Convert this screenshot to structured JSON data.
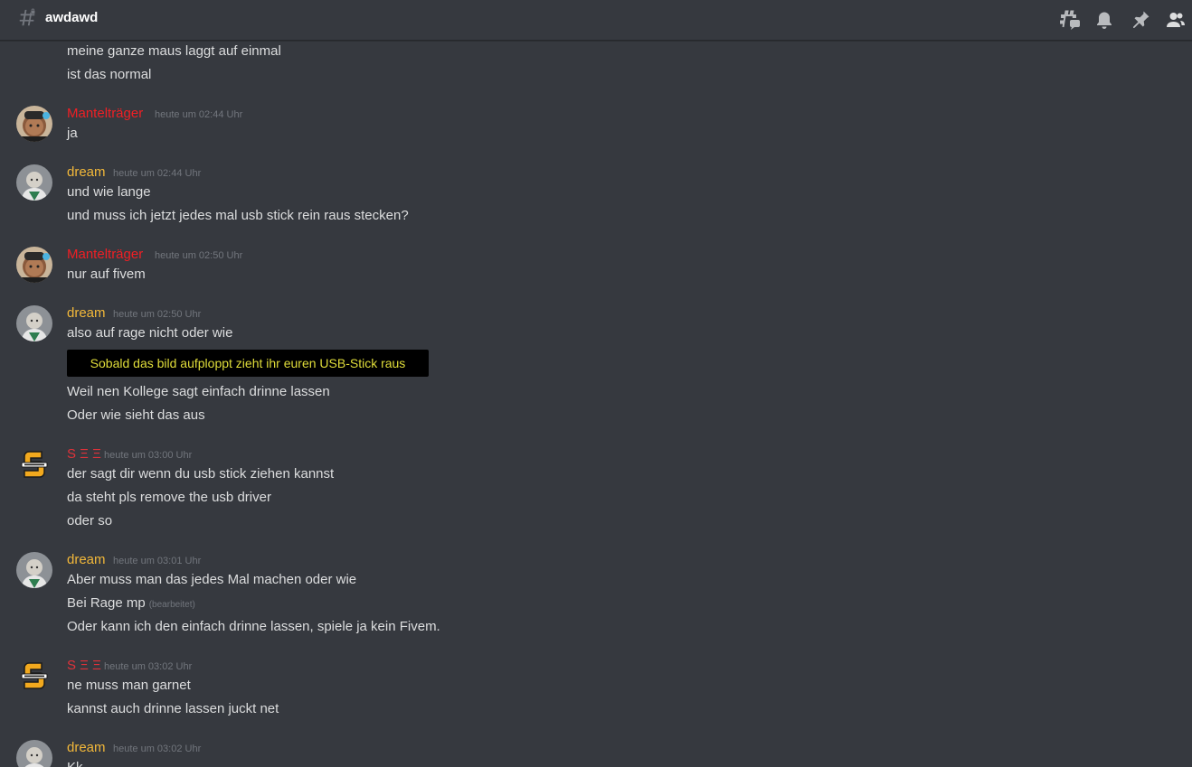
{
  "channel": {
    "name": "awdawd",
    "icons": [
      "threads-icon",
      "bell-icon",
      "pin-icon",
      "members-icon"
    ]
  },
  "colors": {
    "mantel": "#f01f24",
    "dream": "#f2b83a",
    "see": "#e0323a",
    "timestamp": "#72767d",
    "text": "#dcddde"
  },
  "messages": [
    {
      "lines": [
        "meine ganze maus laggt auf einmal",
        "ist das normal"
      ]
    },
    {
      "author": "Mantelträger",
      "time": "heute um 02:44 Uhr",
      "lines": [
        "ja"
      ]
    },
    {
      "author": "dream",
      "time": "heute um 02:44 Uhr",
      "lines": [
        "und wie lange",
        "und muss ich jetzt jedes mal usb stick rein raus stecken?"
      ]
    },
    {
      "author": "Mantelträger",
      "time": "heute um 02:50 Uhr",
      "lines": [
        "nur auf fivem"
      ]
    },
    {
      "author": "dream",
      "time": "heute um 02:50 Uhr",
      "lines": [
        "also auf rage nicht oder wie",
        "Weil nen Kollege sagt einfach drinne lassen",
        "Oder wie sieht das aus"
      ],
      "embed": "Sobald das bild aufploppt zieht ihr euren USB-Stick raus"
    },
    {
      "author": "S Ξ Ξ",
      "time": "heute um 03:00 Uhr",
      "lines": [
        "der sagt dir wenn du usb stick ziehen kannst",
        "da steht pls remove the usb driver",
        "oder so"
      ]
    },
    {
      "author": "dream",
      "time": "heute um 03:01 Uhr",
      "lines": [
        "Aber muss man das jedes Mal machen oder wie",
        "Bei Rage mp",
        "Oder kann ich den einfach drinne lassen, spiele ja kein Fivem."
      ],
      "edited": "(bearbeitet)"
    },
    {
      "author": "S Ξ Ξ",
      "time": "heute um 03:02 Uhr",
      "lines": [
        "ne muss man garnet",
        "kannst auch drinne lassen juckt net"
      ]
    },
    {
      "author": "dream",
      "time": "heute um 03:02 Uhr",
      "lines": [
        "Kk"
      ]
    }
  ]
}
